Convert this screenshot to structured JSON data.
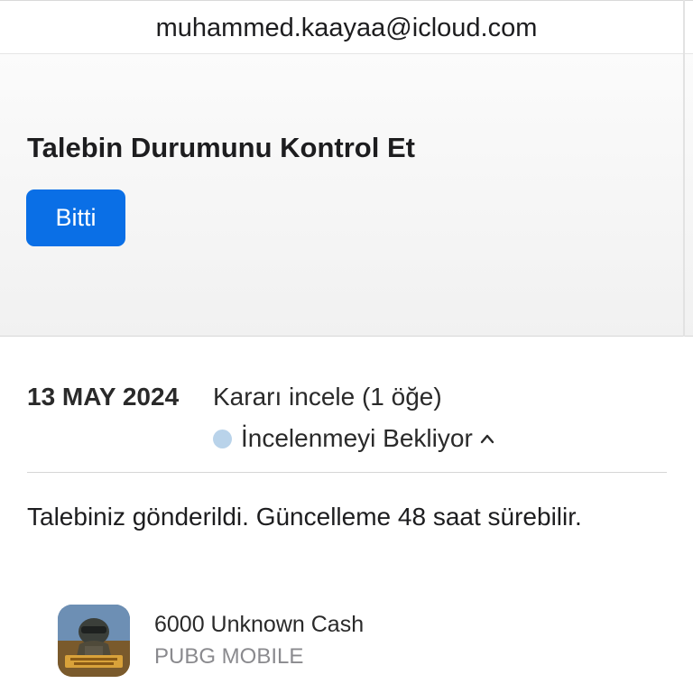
{
  "account": {
    "email": "muhammed.kaayaa@icloud.com"
  },
  "panel": {
    "title": "Talebin Durumunu Kontrol Et",
    "done_label": "Bitti"
  },
  "request": {
    "date": "13 MAY 2024",
    "title": "Kararı incele (1 öğe)",
    "status": "İncelenmeyi Bekliyor",
    "status_color": "#b9d3ea"
  },
  "message": "Talebiniz gönderildi. Güncelleme 48 saat sürebilir.",
  "item": {
    "name": "6000 Unknown Cash",
    "publisher": "PUBG MOBILE",
    "icon": "pubg-mobile-app-icon"
  },
  "colors": {
    "accent": "#0a6fe6",
    "secondary_text": "#8a8a8e"
  }
}
